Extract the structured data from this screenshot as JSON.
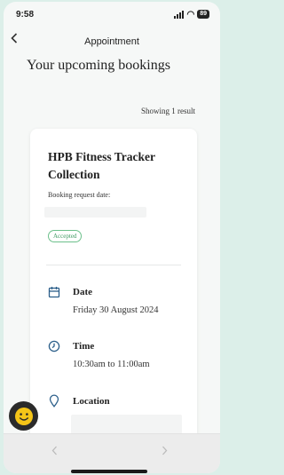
{
  "status": {
    "time": "9:58",
    "battery": "89"
  },
  "nav": {
    "back_icon": "chevron-left-icon",
    "title": "Appointment"
  },
  "heading": "Your upcoming bookings",
  "results_text": "Showing 1 result",
  "booking": {
    "title": "HPB Fitness Tracker Collection",
    "request_date_label": "Booking request date:",
    "status": "Accepted",
    "status_color": "#3e9a62",
    "date_label": "Date",
    "date_value": "Friday 30 August 2024",
    "time_label": "Time",
    "time_value": "10:30am to 11:00am",
    "location_label": "Location"
  },
  "toolbar": {
    "back_icon": "chevron-left-icon",
    "forward_icon": "chevron-right-icon"
  },
  "fab": {
    "icon": "smiley-face-icon",
    "color": "#f5c518"
  },
  "accent_color": "#2c5f8a"
}
